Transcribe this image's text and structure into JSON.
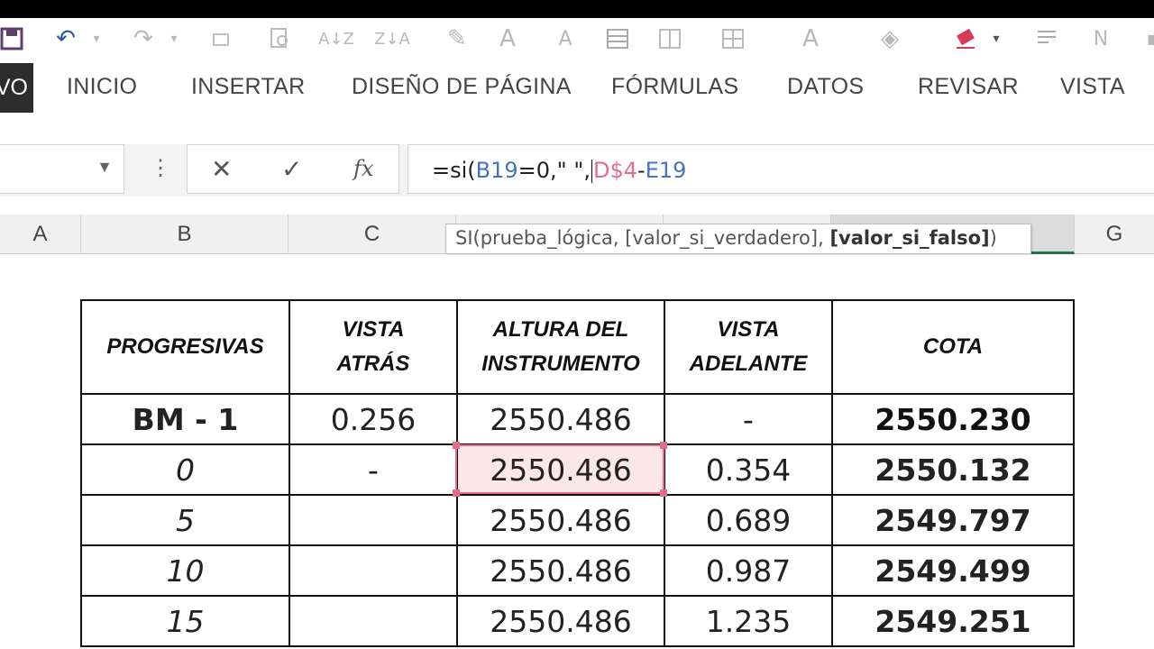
{
  "quick_access": {
    "icons": [
      "save-icon",
      "undo-icon",
      "redo-icon",
      "print-preview-icon",
      "sort-asc-icon",
      "sort-desc-icon",
      "format-painter-icon",
      "font-grow-icon",
      "font-shrink-icon",
      "borders-icon",
      "merge-icon",
      "cell-styles-icon",
      "font-color-icon",
      "fill-color-icon",
      "eraser-icon",
      "wrap-text-icon",
      "bold-icon"
    ],
    "undo_glyph": "↶",
    "redo_glyph": "↷"
  },
  "ribbon": {
    "file_tab": "VO",
    "tabs": [
      "INICIO",
      "INSERTAR",
      "DISEÑO DE PÁGINA",
      "FÓRMULAS",
      "DATOS",
      "REVISAR",
      "VISTA"
    ]
  },
  "formula_bar": {
    "cancel": "✕",
    "enter": "✓",
    "fx": "fx",
    "formula_prefix": "=si(",
    "ref1": "B19",
    "formula_mid": "=0,\" \",",
    "ref2": "D$4",
    "formula_end_op": "-",
    "ref3": "E19"
  },
  "tooltip": {
    "text": "SI(prueba_lógica, [valor_si_verdadero], ",
    "bold_arg": "[valor_si_falso]",
    "close": ")"
  },
  "columns": [
    "A",
    "B",
    "C",
    "",
    "",
    "",
    "G"
  ],
  "table": {
    "headers": {
      "progresivas": "PROGRESIVAS",
      "vista_atras_1": "VISTA",
      "vista_atras_2": "ATRÁS",
      "altura_1": "ALTURA DEL",
      "altura_2": "INSTRUMENTO",
      "vista_adelante_1": "VISTA",
      "vista_adelante_2": "ADELANTE",
      "cota": "COTA"
    },
    "rows": [
      {
        "prog": "BM - 1",
        "va": "0.256",
        "ai": "2550.486",
        "vad": "-",
        "cota": "2550.230"
      },
      {
        "prog": "0",
        "va": "-",
        "ai": "2550.486",
        "vad": "0.354",
        "cota": "2550.132"
      },
      {
        "prog": "5",
        "va": "",
        "ai": "2550.486",
        "vad": "0.689",
        "cota": "2549.797"
      },
      {
        "prog": "10",
        "va": "",
        "ai": "2550.486",
        "vad": "0.987",
        "cota": "2549.499"
      },
      {
        "prog": "15",
        "va": "",
        "ai": "2550.486",
        "vad": "1.235",
        "cota": "2549.251"
      }
    ]
  },
  "colors": {
    "accent_green": "#217346",
    "ref_blue": "#4472c4",
    "ref_red": "#e46c8a",
    "cota_green": "#4e6b33"
  }
}
